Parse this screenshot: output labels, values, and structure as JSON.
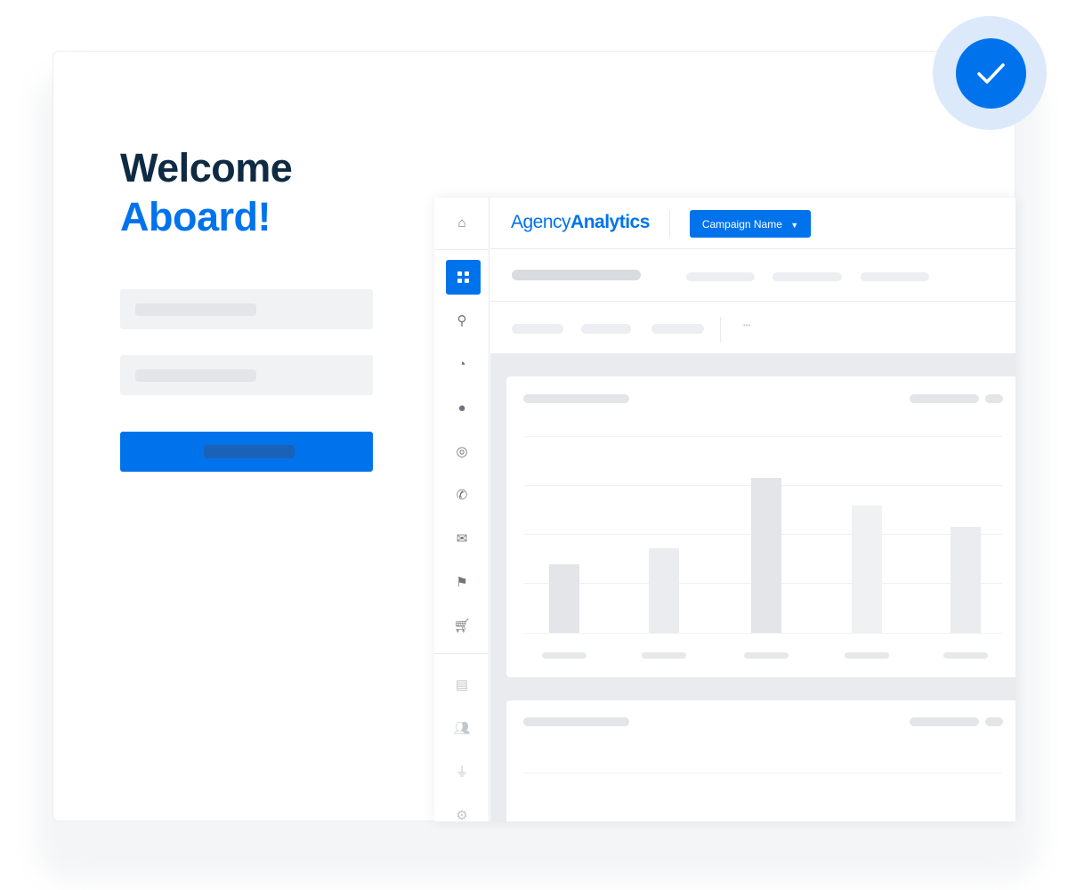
{
  "welcome": {
    "line1": "Welcome",
    "line2": "Aboard!"
  },
  "colors": {
    "brand": "#0073ec",
    "heading": "#0f2a44"
  },
  "status": {
    "icon": "checkmark-icon"
  },
  "header": {
    "logo_light": "Agency",
    "logo_bold": "Analytics",
    "campaign_button": "Campaign Name",
    "dropdown_icon": "caret-down-icon"
  },
  "sidebar": {
    "items": [
      "home-icon",
      "dashboard-icon",
      "search-icon",
      "pie-chart-icon",
      "chat-icon",
      "target-icon",
      "phone-icon",
      "mail-icon",
      "map-pin-icon",
      "cart-icon",
      "report-icon",
      "users-icon",
      "plug-icon",
      "gear-icon"
    ],
    "active": "dashboard-icon"
  },
  "subnav": {
    "more": "•••"
  },
  "chart_placeholder": {
    "bar_levels": [
      0.35,
      0.43,
      0.79,
      0.65,
      0.54
    ]
  }
}
